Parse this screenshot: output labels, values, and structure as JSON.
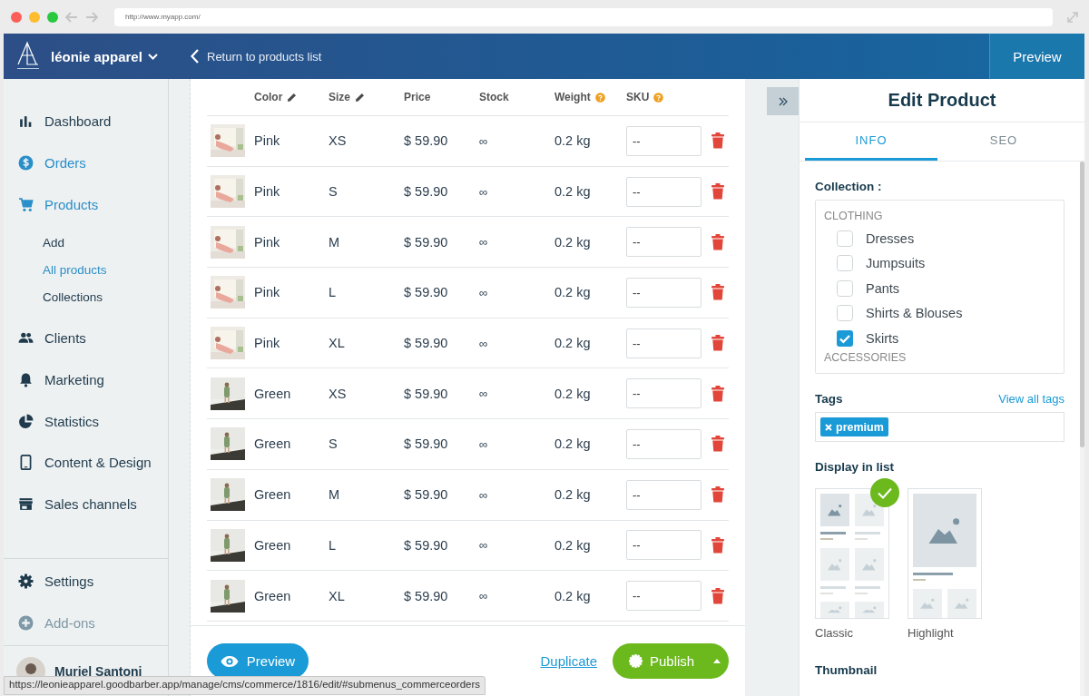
{
  "browser": {
    "url": "http://www.myapp.com/"
  },
  "top_bar": {
    "brand": "léonie apparel",
    "back_link": "Return to products list",
    "preview_button": "Preview"
  },
  "sidebar": {
    "items": [
      {
        "label": "Dashboard",
        "selected": false,
        "disabled": false
      },
      {
        "label": "Orders",
        "selected": true,
        "disabled": false
      },
      {
        "label": "Products",
        "selected": true,
        "disabled": false,
        "children": [
          {
            "label": "Add",
            "selected": false
          },
          {
            "label": "All products",
            "selected": true
          },
          {
            "label": "Collections",
            "selected": false
          }
        ]
      },
      {
        "label": "Clients",
        "selected": false,
        "disabled": false
      },
      {
        "label": "Marketing",
        "selected": false,
        "disabled": false
      },
      {
        "label": "Statistics",
        "selected": false,
        "disabled": false
      },
      {
        "label": "Content & Design",
        "selected": false,
        "disabled": false
      },
      {
        "label": "Sales channels",
        "selected": false,
        "disabled": false
      }
    ],
    "bottom_items": [
      {
        "label": "Settings",
        "disabled": false
      },
      {
        "label": "Add-ons",
        "disabled": true
      }
    ],
    "user": {
      "name": "Muriel Santoni"
    }
  },
  "table": {
    "columns": [
      {
        "label": "Color",
        "kind": "editable"
      },
      {
        "label": "Size",
        "kind": "editable"
      },
      {
        "label": "Price",
        "kind": "plain"
      },
      {
        "label": "Stock",
        "kind": "plain"
      },
      {
        "label": "Weight",
        "kind": "help"
      },
      {
        "label": "SKU",
        "kind": "help"
      }
    ],
    "rows": [
      {
        "photo": {
          "kind": "interior"
        },
        "variant": "Pink",
        "size": "XS",
        "price": "$ 59.90",
        "stock": "∞",
        "weight": "0.2 kg",
        "sku": "--"
      },
      {
        "photo": {
          "kind": "interior"
        },
        "variant": "Pink",
        "size": "S",
        "price": "$ 59.90",
        "stock": "∞",
        "weight": "0.2 kg",
        "sku": "--"
      },
      {
        "photo": {
          "kind": "interior"
        },
        "variant": "Pink",
        "size": "M",
        "price": "$ 59.90",
        "stock": "∞",
        "weight": "0.2 kg",
        "sku": "--"
      },
      {
        "photo": {
          "kind": "interior"
        },
        "variant": "Pink",
        "size": "L",
        "price": "$ 59.90",
        "stock": "∞",
        "weight": "0.2 kg",
        "sku": "--"
      },
      {
        "photo": {
          "kind": "interior"
        },
        "variant": "Pink",
        "size": "XL",
        "price": "$ 59.90",
        "stock": "∞",
        "weight": "0.2 kg",
        "sku": "--"
      },
      {
        "photo": {
          "kind": "outdoor"
        },
        "variant": "Green",
        "size": "XS",
        "price": "$ 59.90",
        "stock": "∞",
        "weight": "0.2 kg",
        "sku": "--"
      },
      {
        "photo": {
          "kind": "outdoor"
        },
        "variant": "Green",
        "size": "S",
        "price": "$ 59.90",
        "stock": "∞",
        "weight": "0.2 kg",
        "sku": "--"
      },
      {
        "photo": {
          "kind": "outdoor"
        },
        "variant": "Green",
        "size": "M",
        "price": "$ 59.90",
        "stock": "∞",
        "weight": "0.2 kg",
        "sku": "--"
      },
      {
        "photo": {
          "kind": "outdoor"
        },
        "variant": "Green",
        "size": "L",
        "price": "$ 59.90",
        "stock": "∞",
        "weight": "0.2 kg",
        "sku": "--"
      },
      {
        "photo": {
          "kind": "outdoor"
        },
        "variant": "Green",
        "size": "XL",
        "price": "$ 59.90",
        "stock": "∞",
        "weight": "0.2 kg",
        "sku": "--"
      }
    ]
  },
  "actions": {
    "preview": "Preview",
    "duplicate": "Duplicate",
    "publish": "Publish"
  },
  "edit_panel": {
    "title": "Edit Product",
    "tabs": [
      {
        "label": "INFO",
        "selected": true
      },
      {
        "label": "SEO",
        "selected": false
      }
    ],
    "collection": {
      "label": "Collection :",
      "groups": [
        {
          "label": "CLOTHING",
          "items": [
            {
              "label": "Dresses",
              "checked": false
            },
            {
              "label": "Jumpsuits",
              "checked": false
            },
            {
              "label": "Pants",
              "checked": false
            },
            {
              "label": "Shirts & Blouses",
              "checked": false
            },
            {
              "label": "Skirts",
              "checked": true
            }
          ]
        },
        {
          "label": "ACCESSORIES"
        }
      ]
    },
    "tags": {
      "label": "Tags",
      "link": "View all tags",
      "items": [
        "premium"
      ]
    },
    "display": {
      "label": "Display in list",
      "options": [
        {
          "label": "Classic",
          "kind": "classic",
          "selected": true
        },
        {
          "label": "Highlight",
          "kind": "highlight",
          "selected": false
        }
      ]
    },
    "thumbnail": {
      "label": "Thumbnail"
    }
  },
  "status_bar": {
    "url": "https://leonieapparel.goodbarber.app/manage/cms/commerce/1816/edit/#submenus_commerceorders"
  }
}
